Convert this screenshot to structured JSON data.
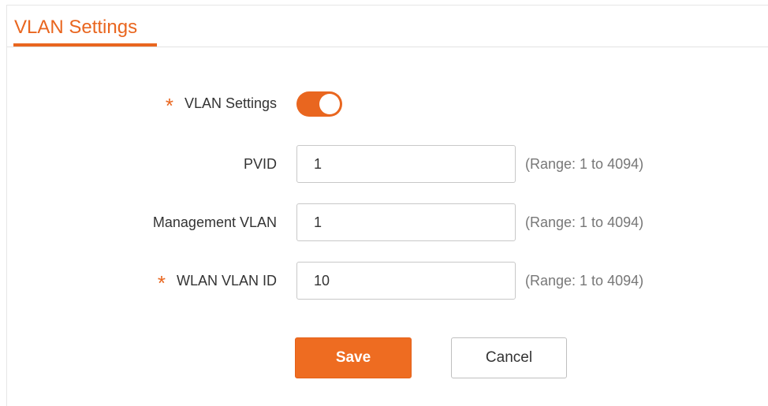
{
  "header": {
    "title": "VLAN Settings"
  },
  "form": {
    "vlan_settings": {
      "label": "VLAN Settings",
      "required_mark": "*",
      "enabled": true
    },
    "pvid": {
      "label": "PVID",
      "value": "1",
      "hint": "(Range: 1 to 4094)"
    },
    "management_vlan": {
      "label": "Management VLAN",
      "value": "1",
      "hint": "(Range: 1 to 4094)"
    },
    "wlan_vlan_id": {
      "label": "WLAN VLAN ID",
      "required_mark": "*",
      "value": "10",
      "hint": "(Range: 1 to 4094)"
    }
  },
  "actions": {
    "save_label": "Save",
    "cancel_label": "Cancel"
  },
  "colors": {
    "accent": "#e9661f",
    "save_button": "#ee6c21"
  }
}
